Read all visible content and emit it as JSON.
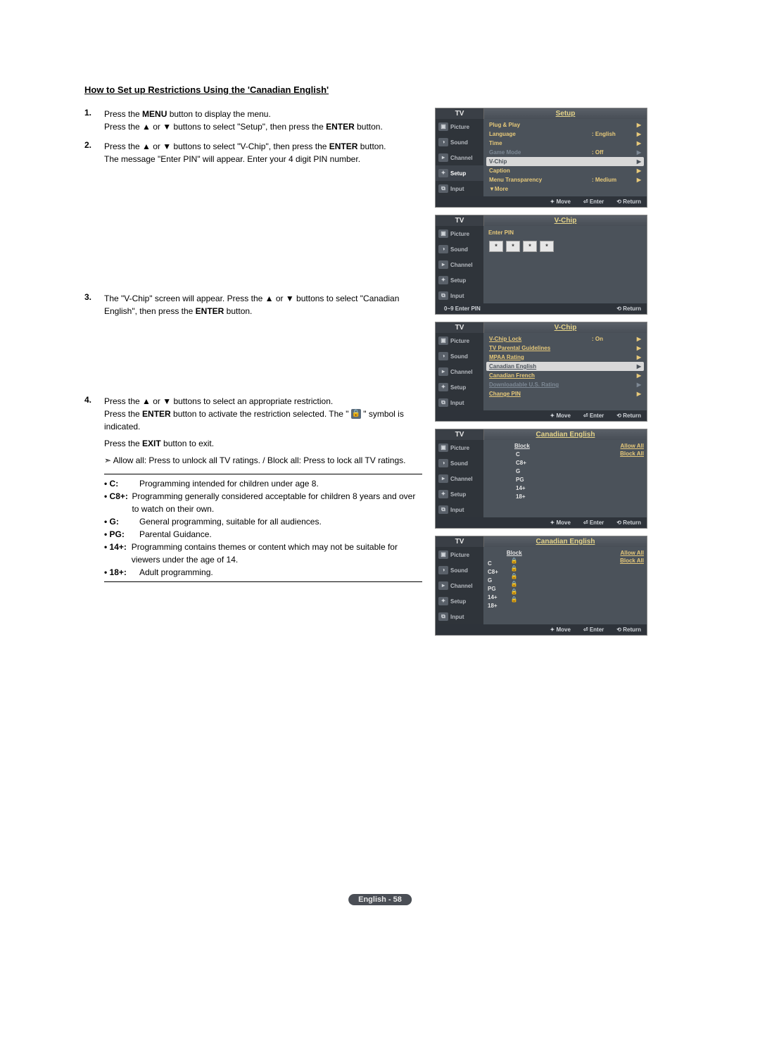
{
  "title": "How to Set up Restrictions Using the 'Canadian English'",
  "steps": {
    "s1": {
      "num": "1.",
      "a": "Press the ",
      "a_bold": "MENU",
      "a_after": " button to display the menu.",
      "b_before": "Press the ▲ or ▼ buttons to select \"Setup\", then press the ",
      "b_bold": "ENTER",
      "b_after": " button."
    },
    "s2": {
      "num": "2.",
      "a_before": "Press the ▲ or ▼ buttons to select \"V-Chip\", then press the ",
      "a_bold": "ENTER",
      "a_after": " button.",
      "b": "The message \"Enter PIN\" will appear. Enter your 4 digit PIN number."
    },
    "s3": {
      "num": "3.",
      "a_before": "The \"V-Chip\" screen will appear. Press the ▲ or ▼ buttons to select \"Canadian English\", then press the ",
      "a_bold": "ENTER",
      "a_after": " button."
    },
    "s4": {
      "num": "4.",
      "a": "Press the ▲ or ▼ buttons to select an appropriate restriction.",
      "b_before": "Press the ",
      "b_bold": "ENTER",
      "b_after": " button to activate the restriction selected. The \" ",
      "b_tail": " \" symbol is indicated.",
      "c_before": "Press the ",
      "c_bold": "EXIT",
      "c_after": " button to exit.",
      "note": "Allow all: Press to unlock all TV ratings. / Block all: Press to lock all TV ratings."
    }
  },
  "defs": [
    {
      "label": "• C:",
      "text": "Programming intended for children under age 8."
    },
    {
      "label": "• C8+:",
      "text": "Programming generally considered acceptable for children 8 years and over to watch on their own."
    },
    {
      "label": "• G:",
      "text": "General programming, suitable for all audiences."
    },
    {
      "label": "• PG:",
      "text": "Parental Guidance."
    },
    {
      "label": "• 14+:",
      "text": "Programming contains themes or content which may not be suitable for viewers under the age of 14."
    },
    {
      "label": "• 18+:",
      "text": "Adult programming."
    }
  ],
  "osd_side": {
    "picture": "Picture",
    "sound": "Sound",
    "channel": "Channel",
    "setup": "Setup",
    "input": "Input"
  },
  "osd1": {
    "tv": "TV",
    "title": "Setup",
    "rows": [
      {
        "label": "Plug & Play",
        "val": "",
        "hl": false,
        "dim": false
      },
      {
        "label": "Language",
        "val": ": English",
        "hl": false,
        "dim": false
      },
      {
        "label": "Time",
        "val": "",
        "hl": false,
        "dim": false
      },
      {
        "label": "Game Mode",
        "val": ": Off",
        "hl": false,
        "dim": true
      },
      {
        "label": "V-Chip",
        "val": "",
        "hl": true,
        "dim": false
      },
      {
        "label": "Caption",
        "val": "",
        "hl": false,
        "dim": false
      },
      {
        "label": "Menu Transparency",
        "val": ": Medium",
        "hl": false,
        "dim": false
      },
      {
        "label": "▼More",
        "val": "",
        "hl": false,
        "dim": false,
        "nocaret": true
      }
    ],
    "foot": {
      "move": "Move",
      "enter": "Enter",
      "return": "Return"
    }
  },
  "osd2": {
    "tv": "TV",
    "title": "V-Chip",
    "enter_pin": "Enter PIN",
    "pin_hint": "0~9 Enter PIN",
    "return": "Return"
  },
  "osd3": {
    "tv": "TV",
    "title": "V-Chip",
    "rows": [
      {
        "label": "V-Chip Lock",
        "val": ": On"
      },
      {
        "label": "TV Parental Guidelines",
        "val": ""
      },
      {
        "label": "MPAA Rating",
        "val": ""
      },
      {
        "label": "Canadian English",
        "val": "",
        "hl": true
      },
      {
        "label": "Canadian French",
        "val": ""
      },
      {
        "label": "Downloadable U.S. Rating",
        "val": "",
        "dim": true
      },
      {
        "label": "Change PIN",
        "val": ""
      }
    ],
    "foot": {
      "move": "Move",
      "enter": "Enter",
      "return": "Return"
    }
  },
  "osd4": {
    "tv": "TV",
    "title": "Canadian English",
    "block": "Block",
    "allow": "Allow All",
    "blockall": "Block All",
    "ratings": [
      "C",
      "C8+",
      "G",
      "PG",
      "14+",
      "18+"
    ],
    "foot": {
      "move": "Move",
      "enter": "Enter",
      "return": "Return"
    }
  },
  "osd5": {
    "tv": "TV",
    "title": "Canadian English",
    "block": "Block",
    "allow": "Allow All",
    "blockall": "Block All",
    "ratings": [
      "C",
      "C8+",
      "G",
      "PG",
      "14+",
      "18+"
    ],
    "foot": {
      "move": "Move",
      "enter": "Enter",
      "return": "Return"
    }
  },
  "page_footer": "English - 58"
}
